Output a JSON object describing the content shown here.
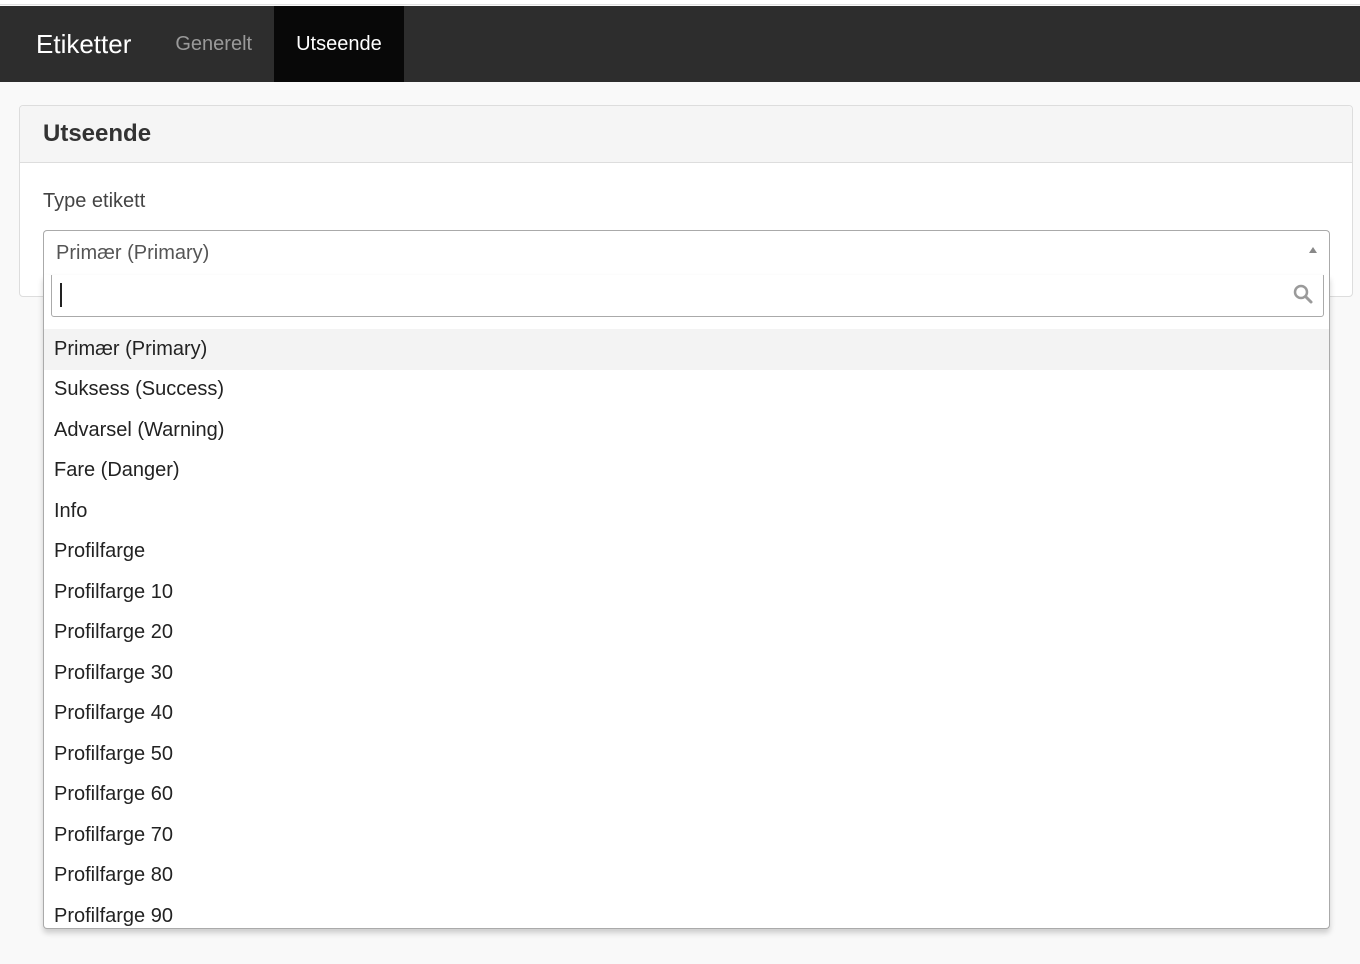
{
  "navbar": {
    "brand": "Etiketter",
    "tabs": [
      {
        "label": "Generelt",
        "active": false
      },
      {
        "label": "Utseende",
        "active": true
      }
    ]
  },
  "panel": {
    "title": "Utseende",
    "field_label": "Type etikett",
    "select": {
      "selected_value": "Primær (Primary)",
      "search_value": "",
      "options": [
        "Primær (Primary)",
        "Suksess (Success)",
        "Advarsel (Warning)",
        "Fare (Danger)",
        "Info",
        "Profilfarge",
        "Profilfarge 10",
        "Profilfarge 20",
        "Profilfarge 30",
        "Profilfarge 40",
        "Profilfarge 50",
        "Profilfarge 60",
        "Profilfarge 70",
        "Profilfarge 80",
        "Profilfarge 90"
      ],
      "highlighted_index": 0
    }
  },
  "colors": {
    "navbar_bg": "#2d2d2d",
    "active_tab_bg": "#080808",
    "highlight_bg": "#f3f3f3"
  },
  "icons": {
    "search": "search-icon",
    "arrow": "arrow-up-icon"
  }
}
